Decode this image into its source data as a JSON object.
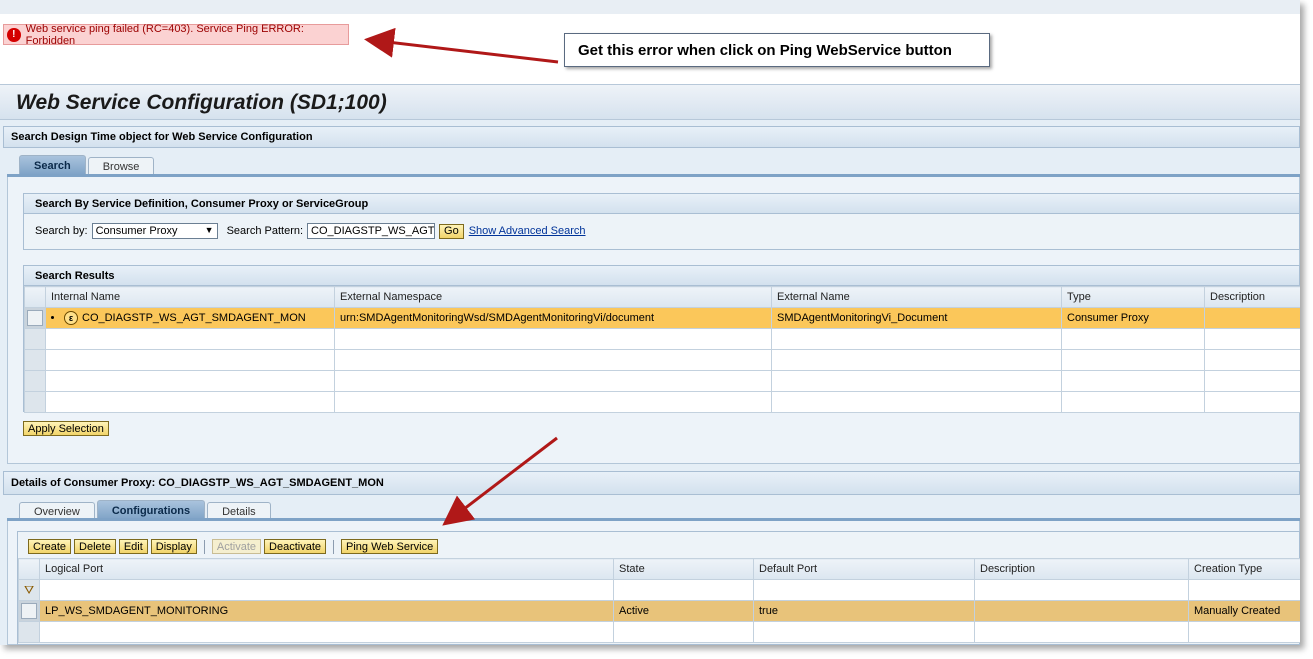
{
  "error": {
    "message": "Web service ping failed (RC=403). Service Ping ERROR: Forbidden"
  },
  "annotation": {
    "callout": "Get this error when click on Ping WebService button"
  },
  "page": {
    "title": "Web Service Configuration (SD1;100)"
  },
  "search_section": {
    "header": "Search Design Time object for Web Service Configuration",
    "tabs": [
      "Search",
      "Browse"
    ],
    "group_header": "Search By Service Definition, Consumer Proxy or ServiceGroup",
    "search_by_label": "Search by:",
    "search_by_value": "Consumer Proxy",
    "pattern_label": "Search Pattern:",
    "pattern_value": "CO_DIAGSTP_WS_AGT_SMDAGENT_MON",
    "go_label": "Go",
    "advanced_link": "Show Advanced Search"
  },
  "results": {
    "header": "Search Results",
    "columns": [
      "Internal Name",
      "External Namespace",
      "External Name",
      "Type",
      "Description"
    ],
    "rows": [
      [
        "CO_DIAGSTP_WS_AGT_SMDAGENT_MON",
        "urn:SMDAgentMonitoringWsd/SMDAgentMonitoringVi/document",
        "SMDAgentMonitoringVi_Document",
        "Consumer Proxy",
        ""
      ]
    ],
    "apply_label": "Apply Selection"
  },
  "details": {
    "header": "Details of Consumer Proxy: CO_DIAGSTP_WS_AGT_SMDAGENT_MON",
    "tabs": [
      "Overview",
      "Configurations",
      "Details"
    ],
    "toolbar": {
      "create": "Create",
      "delete": "Delete",
      "edit": "Edit",
      "display": "Display",
      "activate": "Activate",
      "deactivate": "Deactivate",
      "ping": "Ping Web Service"
    },
    "columns": [
      "Logical Port",
      "State",
      "Default Port",
      "Description",
      "Creation Type"
    ],
    "rows": [
      [
        "LP_WS_SMDAGENT_MONITORING",
        "Active",
        "true",
        "",
        "Manually Created"
      ]
    ]
  },
  "colors": {
    "highlight": "#fbc75a",
    "error_bg": "#fbd2d2",
    "arrow": "#b01818"
  }
}
